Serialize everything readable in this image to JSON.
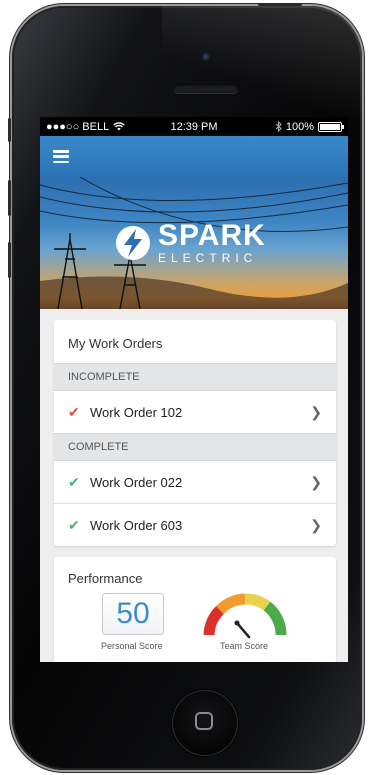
{
  "status_bar": {
    "carrier": "●●●○○ BELL",
    "time": "12:39 PM",
    "battery": "100%"
  },
  "hero": {
    "logo_word": "SPARK",
    "logo_subword": "ELECTRIC"
  },
  "work_orders": {
    "title": "My Work Orders",
    "sections": [
      {
        "label": "INCOMPLETE",
        "items": [
          {
            "label": "Work Order 102",
            "status": "incomplete"
          }
        ]
      },
      {
        "label": "COMPLETE",
        "items": [
          {
            "label": "Work Order 022",
            "status": "complete"
          },
          {
            "label": "Work Order 603",
            "status": "complete"
          }
        ]
      }
    ]
  },
  "performance": {
    "title": "Performance",
    "personal_score": "50",
    "personal_label": "Personal Score",
    "team_label": "Team Score"
  },
  "colors": {
    "accent": "#3b88c8",
    "incomplete": "#e04a4a",
    "complete": "#4bb37a",
    "gauge": [
      "#d9302c",
      "#f29a2e",
      "#e9d24a",
      "#4daa4a"
    ]
  }
}
